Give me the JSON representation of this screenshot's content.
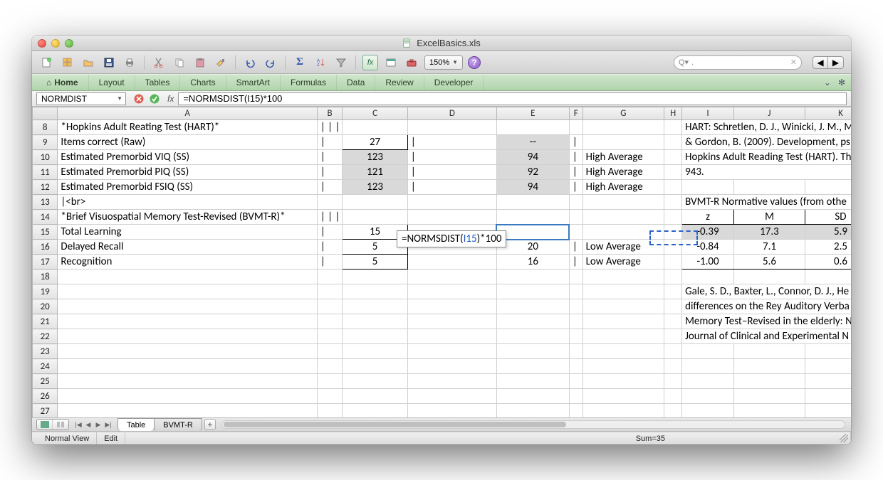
{
  "window": {
    "title": "ExcelBasics.xls"
  },
  "toolbar": {
    "zoom": "150%",
    "search_placeholder": ".",
    "search_prefix": "Q▾"
  },
  "ribbon": {
    "tabs": [
      "Home",
      "Layout",
      "Tables",
      "Charts",
      "SmartArt",
      "Formulas",
      "Data",
      "Review",
      "Developer"
    ]
  },
  "formula_bar": {
    "name_box": "NORMDIST",
    "formula": "=NORMSDIST(I15)*100"
  },
  "columns": [
    "A",
    "B",
    "C",
    "D",
    "E",
    "F",
    "G",
    "H",
    "I",
    "J",
    "K"
  ],
  "row_start": 8,
  "row_end": 27,
  "rows": {
    "8": {
      "A": "*Hopkins Adult Reating Test (HART)*",
      "B": "| | | |",
      "I": "HART: Schretlen, D. J., Winicki, J. M., M"
    },
    "9": {
      "A": "Items correct (Raw)",
      "B": "|",
      "C": "27",
      "D": "|",
      "E": "--",
      "F": "|",
      "I": "& Gordon, B. (2009). Development, ps"
    },
    "10": {
      "A": "Estimated Premorbid VIQ (SS)",
      "B": "|",
      "C": "123",
      "D": "|",
      "E": "94",
      "F": "|",
      "G": "High Average",
      "I": "Hopkins Adult Reading Test (HART). Th"
    },
    "11": {
      "A": "Estimated Premorbid PIQ (SS)",
      "B": "|",
      "C": "121",
      "D": "|",
      "E": "92",
      "F": "|",
      "G": "High Average",
      "I": "943."
    },
    "12": {
      "A": "Estimated Premorbid FSIQ (SS)",
      "B": "|",
      "C": "123",
      "D": "|",
      "E": "94",
      "F": "|",
      "G": "High Average"
    },
    "13": {
      "A": "|<br>",
      "I": "BVMT-R Normative values (from othe"
    },
    "14": {
      "A": "*Brief Visuospatial Memory Test-Revised (BVMT-R)*",
      "B": "| | | |",
      "I": "z",
      "J": "M",
      "K": "SD"
    },
    "15": {
      "A": "Total Learning",
      "B": "|",
      "C": "15",
      "I": "-0.39",
      "J": "17.3",
      "K": "5.9"
    },
    "16": {
      "A": "Delayed Recall",
      "B": "|",
      "C": "5",
      "E": "20",
      "F": "|",
      "G": "Low Average",
      "I": "-0.84",
      "J": "7.1",
      "K": "2.5"
    },
    "17": {
      "A": "Recognition",
      "B": "|",
      "C": "5",
      "E": "16",
      "F": "|",
      "G": "Low Average",
      "I": "-1.00",
      "J": "5.6",
      "K": "0.6"
    },
    "19": {
      "I": "Gale, S. D., Baxter, L., Connor, D. J., He"
    },
    "20": {
      "I": "differences on the Rey Auditory Verba"
    },
    "21": {
      "I": "Memory Test–Revised in the elderly: N"
    },
    "22": {
      "I": "Journal of Clinical and Experimental N"
    }
  },
  "floating_formula": {
    "pre": "=NORMSDIST(",
    "ref": "I15",
    "post": ")*100"
  },
  "sheet_tabs": [
    "Table",
    "BVMT-R"
  ],
  "status": {
    "view": "Normal View",
    "mode": "Edit",
    "sum": "Sum=35"
  }
}
